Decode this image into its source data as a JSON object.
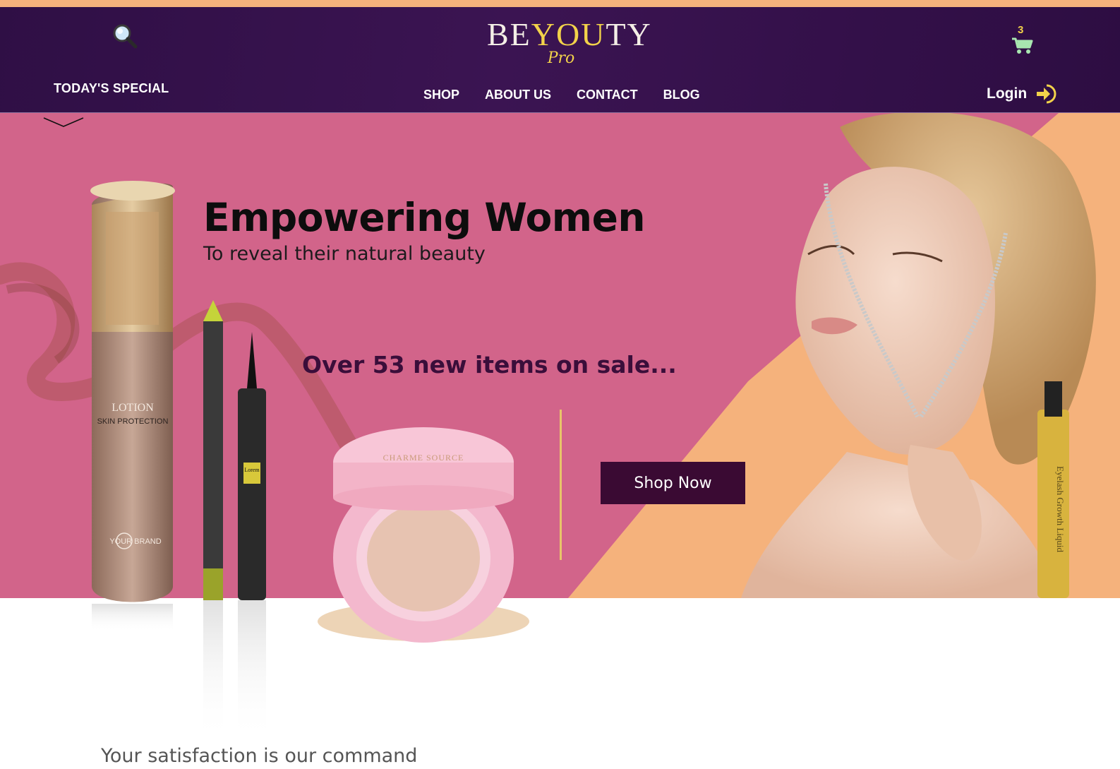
{
  "header": {
    "logo_main_prefix": "BE",
    "logo_main_highlight": "YOU",
    "logo_main_suffix": "TY",
    "logo_sub": "Pro",
    "todays_special": "TODAY'S SPECIAL",
    "nav": [
      "SHOP",
      "ABOUT US",
      "CONTACT",
      "BLOG"
    ],
    "cart_count": "3",
    "login_label": "Login",
    "icons": {
      "search": "search-icon",
      "cart": "cart-icon",
      "login": "login-arrow-icon",
      "dropdown": "chevron-down-icon"
    }
  },
  "hero": {
    "headline": "Empowering Women",
    "subheadline": "To reveal their natural beauty",
    "sale_text": "Over 53 new items on sale...",
    "cta_label": "Shop Now",
    "product_labels": {
      "lotion": "LOTION",
      "lotion_sub": "SKIN PROTECTION",
      "brand": "YOUR BRAND",
      "pen_label": "Lorem",
      "cushion_brand": "CHARME SOURCE",
      "lash": "Eyelash Growth Liquid"
    }
  },
  "footer_teaser": {
    "tagline": "Your satisfaction is our command"
  },
  "colors": {
    "top_strip": "#f5b27c",
    "navbar": "#3b1452",
    "hero_pink": "#d2648a",
    "hero_peach": "#f5b27c",
    "accent_gold": "#f2d24a",
    "cta_bg": "#3a0a33",
    "sale_text": "#3a0e3a"
  }
}
